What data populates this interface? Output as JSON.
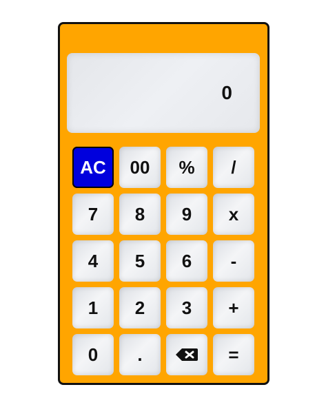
{
  "display": {
    "value": "0"
  },
  "keys": [
    {
      "label": "AC",
      "name": "clear-button"
    },
    {
      "label": "00",
      "name": "double-zero-button"
    },
    {
      "label": "%",
      "name": "percent-button"
    },
    {
      "label": "/",
      "name": "divide-button"
    },
    {
      "label": "7",
      "name": "seven-button"
    },
    {
      "label": "8",
      "name": "eight-button"
    },
    {
      "label": "9",
      "name": "nine-button"
    },
    {
      "label": "x",
      "name": "multiply-button"
    },
    {
      "label": "4",
      "name": "four-button"
    },
    {
      "label": "5",
      "name": "five-button"
    },
    {
      "label": "6",
      "name": "six-button"
    },
    {
      "label": "-",
      "name": "subtract-button"
    },
    {
      "label": "1",
      "name": "one-button"
    },
    {
      "label": "2",
      "name": "two-button"
    },
    {
      "label": "3",
      "name": "three-button"
    },
    {
      "label": "+",
      "name": "add-button"
    },
    {
      "label": "0",
      "name": "zero-button"
    },
    {
      "label": ".",
      "name": "decimal-button"
    },
    {
      "label": "",
      "name": "backspace-button",
      "icon": "backspace-icon"
    },
    {
      "label": "=",
      "name": "equals-button"
    }
  ],
  "colors": {
    "body": "#ffa500",
    "ac_key": "#0000dd",
    "display_bg": "#eceef1"
  }
}
